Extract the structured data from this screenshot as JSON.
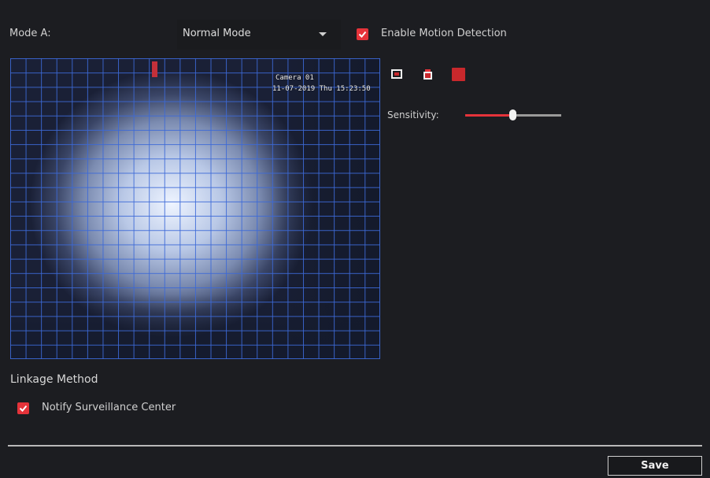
{
  "mode": {
    "label": "Mode A:",
    "selected": "Normal Mode"
  },
  "enable_motion": {
    "checked": true,
    "label": "Enable Motion Detection"
  },
  "video": {
    "osd_line1": "Camera 01",
    "osd_line2": "11-07-2019 Thu 15:23:50"
  },
  "tools": [
    "draw-area-icon",
    "clear-area-icon",
    "select-all-icon"
  ],
  "sensitivity": {
    "label": "Sensitivity:",
    "value_percent": 50
  },
  "linkage": {
    "title": "Linkage Method",
    "notify_label": "Notify Surveillance Center",
    "notify_checked": true
  },
  "footer": {
    "save_label": "Save"
  },
  "colors": {
    "accent": "#e5333a",
    "background": "#1c1d21",
    "grid": "#3c69d7"
  }
}
